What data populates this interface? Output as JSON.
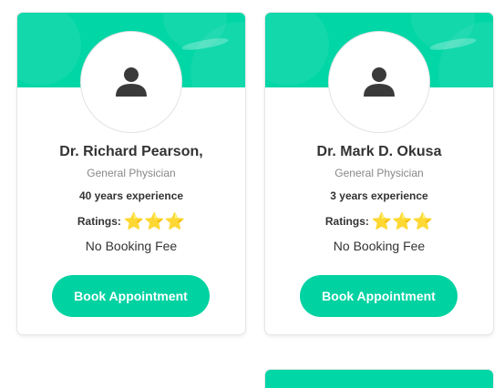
{
  "theme": {
    "accent": "#00d6a6",
    "button": "#00d2a2"
  },
  "cards": [
    {
      "name": "Dr. Richard Pearson,",
      "specialty": "General Physician",
      "experience": "40 years experience",
      "ratings_label": "Ratings:",
      "rating_stars": 3,
      "fee_text": "No Booking Fee",
      "button_label": "Book Appointment",
      "avatar_icon": "user-icon"
    },
    {
      "name": "Dr. Mark D. Okusa",
      "specialty": "General Physician",
      "experience": "3 years experience",
      "ratings_label": "Ratings:",
      "rating_stars": 3,
      "fee_text": "No Booking Fee",
      "button_label": "Book Appointment",
      "avatar_icon": "user-icon"
    }
  ]
}
